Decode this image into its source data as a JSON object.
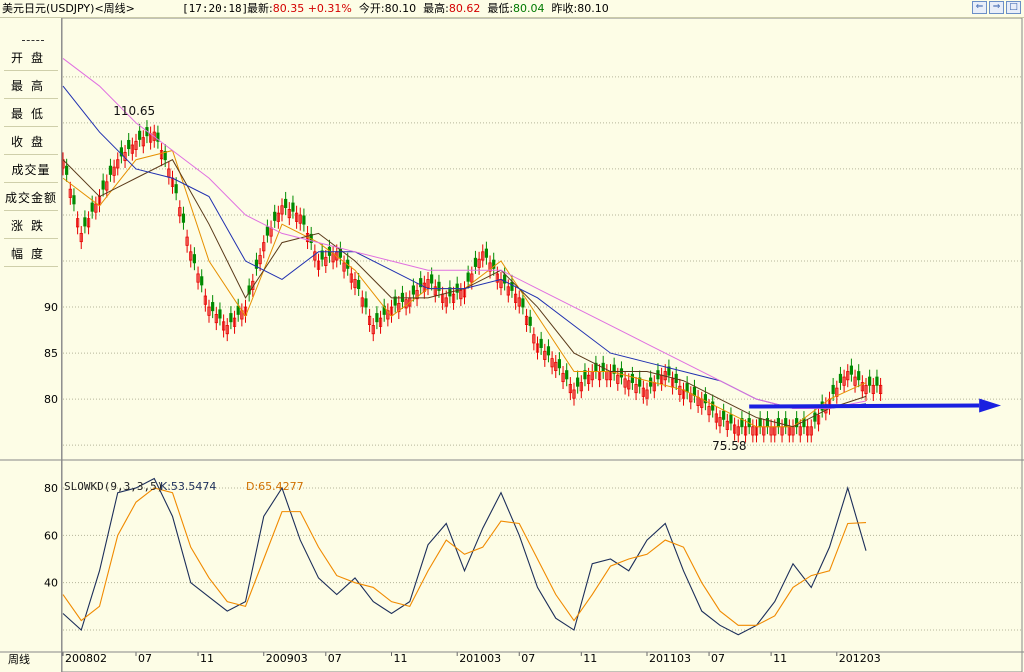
{
  "header": {
    "title": "美元日元(USDJPY)<周线>",
    "time": "[17:20:18]",
    "latest_label": "最新:",
    "latest_value": "80.35",
    "change": "+0.31%",
    "open_label": "今开:",
    "open_value": "80.10",
    "high_label": "最高:",
    "high_value": "80.62",
    "low_label": "最低:",
    "low_value": "80.04",
    "prev_close_label": "昨收:",
    "prev_close_value": "80.10"
  },
  "left_panel": {
    "items": [
      "开盘",
      "最高",
      "最低",
      "收盘",
      "成交量",
      "成交金额",
      "涨跌",
      "幅度"
    ]
  },
  "bottom_label": "周线",
  "colors": {
    "background": "#fdfde6",
    "up_candle": "#e80000",
    "down_candle": "#008a00",
    "k_line": "#1c2e5a",
    "d_line": "#f08a00",
    "ma_short": "#e69000",
    "ma_mid": "#5a3a1a",
    "ma_long": "#2030b0",
    "ma_longest": "#e070e0",
    "arrow": "#1a20e0"
  },
  "chart_data": [
    {
      "type": "line",
      "panel": "price",
      "y_ticks": [
        80,
        85,
        90
      ],
      "ylim": [
        73.5,
        119
      ],
      "x_tick_labels": [
        "200802",
        "07",
        "11",
        "200903",
        "07",
        "11",
        "201003",
        "07",
        "11",
        "201103",
        "07",
        "11",
        "201203"
      ],
      "annotations": [
        {
          "text": "110.65",
          "x": 28,
          "y": 110.65
        },
        {
          "text": "75.58",
          "x": 190,
          "y": 75.58
        }
      ],
      "series": [
        {
          "kind": "candle_close",
          "x": [
            0,
            5,
            10,
            15,
            20,
            25,
            30,
            35,
            40,
            45,
            50,
            55,
            60,
            65,
            70,
            75,
            80,
            85,
            90,
            95,
            100,
            105,
            110,
            115,
            120,
            125,
            130,
            135,
            140,
            145,
            150,
            155,
            160,
            165,
            170,
            175,
            180,
            185,
            190,
            195,
            200,
            205,
            210,
            215,
            220
          ],
          "values": [
            106,
            98,
            102,
            106,
            108,
            109,
            104,
            96,
            90,
            88,
            90,
            97,
            101,
            100,
            95,
            96,
            93,
            88,
            90,
            91,
            93,
            91,
            92,
            96,
            93,
            91,
            86,
            84,
            81,
            83,
            83,
            82,
            81,
            83,
            81,
            80,
            78,
            77,
            77,
            77,
            77,
            77,
            80,
            83,
            81.5
          ]
        },
        {
          "kind": "ma_short",
          "x": [
            0,
            10,
            20,
            30,
            40,
            50,
            60,
            70,
            80,
            90,
            100,
            110,
            120,
            130,
            140,
            150,
            160,
            170,
            180,
            190,
            200,
            210,
            220
          ],
          "values": [
            104,
            101,
            106,
            107,
            95,
            89,
            99,
            97,
            94,
            89,
            92,
            92,
            95,
            89,
            83,
            83,
            82,
            81,
            79,
            77,
            77,
            80,
            81.8
          ]
        },
        {
          "kind": "ma_mid",
          "x": [
            0,
            10,
            20,
            30,
            40,
            50,
            60,
            70,
            80,
            90,
            100,
            110,
            120,
            130,
            140,
            150,
            160,
            170,
            180,
            190,
            200,
            210,
            220
          ],
          "values": [
            106,
            102,
            104,
            106,
            99,
            91,
            97,
            98,
            95,
            91,
            91,
            92,
            94,
            90,
            85,
            83,
            83,
            82,
            80,
            78,
            77,
            79,
            80.3
          ]
        },
        {
          "kind": "ma_long",
          "x": [
            0,
            10,
            20,
            30,
            40,
            50,
            60,
            70,
            80,
            90,
            100,
            110,
            120,
            130,
            140,
            150,
            160,
            170,
            180,
            190,
            200,
            210,
            220
          ],
          "values": [
            114,
            109,
            105,
            104,
            102,
            95,
            93,
            96,
            96,
            94,
            92,
            92,
            93,
            91,
            88,
            85,
            84,
            83,
            82,
            80,
            79,
            79,
            79.5
          ]
        },
        {
          "kind": "ma_longest",
          "x": [
            0,
            10,
            20,
            30,
            40,
            50,
            60,
            70,
            80,
            90,
            100,
            110,
            120,
            130,
            140,
            150,
            160,
            170,
            180,
            190,
            200,
            210,
            220
          ],
          "values": [
            117,
            114,
            110,
            107,
            104,
            100,
            98,
            97,
            96,
            95,
            94,
            94,
            94,
            92,
            90,
            88,
            86,
            84,
            82,
            80,
            79,
            79,
            79.8
          ]
        }
      ]
    },
    {
      "type": "line",
      "panel": "indicator",
      "title": "SLOWKD(9,3,3,5)",
      "k_label": "K:53.5474",
      "d_label": "D:65.4277",
      "y_ticks": [
        40,
        60,
        80
      ],
      "ylim": [
        12,
        88
      ],
      "series": [
        {
          "name": "K",
          "x": [
            0,
            5,
            10,
            15,
            20,
            25,
            30,
            35,
            40,
            45,
            50,
            55,
            60,
            65,
            70,
            75,
            80,
            85,
            90,
            95,
            100,
            105,
            110,
            115,
            120,
            125,
            130,
            135,
            140,
            145,
            150,
            155,
            160,
            165,
            170,
            175,
            180,
            185,
            190,
            195,
            200,
            205,
            210,
            215,
            220
          ],
          "values": [
            27,
            20,
            45,
            78,
            80,
            84,
            68,
            40,
            34,
            28,
            32,
            68,
            80,
            58,
            42,
            35,
            42,
            32,
            27,
            32,
            56,
            65,
            45,
            63,
            78,
            60,
            38,
            25,
            20,
            48,
            50,
            45,
            58,
            65,
            45,
            28,
            22,
            18,
            22,
            32,
            48,
            38,
            55,
            80,
            53.5
          ]
        },
        {
          "name": "D",
          "x": [
            0,
            5,
            10,
            15,
            20,
            25,
            30,
            35,
            40,
            45,
            50,
            55,
            60,
            65,
            70,
            75,
            80,
            85,
            90,
            95,
            100,
            105,
            110,
            115,
            120,
            125,
            130,
            135,
            140,
            145,
            150,
            155,
            160,
            165,
            170,
            175,
            180,
            185,
            190,
            195,
            200,
            205,
            210,
            215,
            220
          ],
          "values": [
            35,
            24,
            30,
            60,
            74,
            80,
            78,
            55,
            42,
            32,
            30,
            50,
            70,
            70,
            55,
            43,
            40,
            38,
            32,
            30,
            45,
            58,
            52,
            55,
            66,
            65,
            50,
            35,
            24,
            35,
            47,
            50,
            52,
            58,
            55,
            40,
            28,
            22,
            22,
            26,
            38,
            43,
            45,
            65,
            65.4
          ]
        }
      ]
    }
  ]
}
